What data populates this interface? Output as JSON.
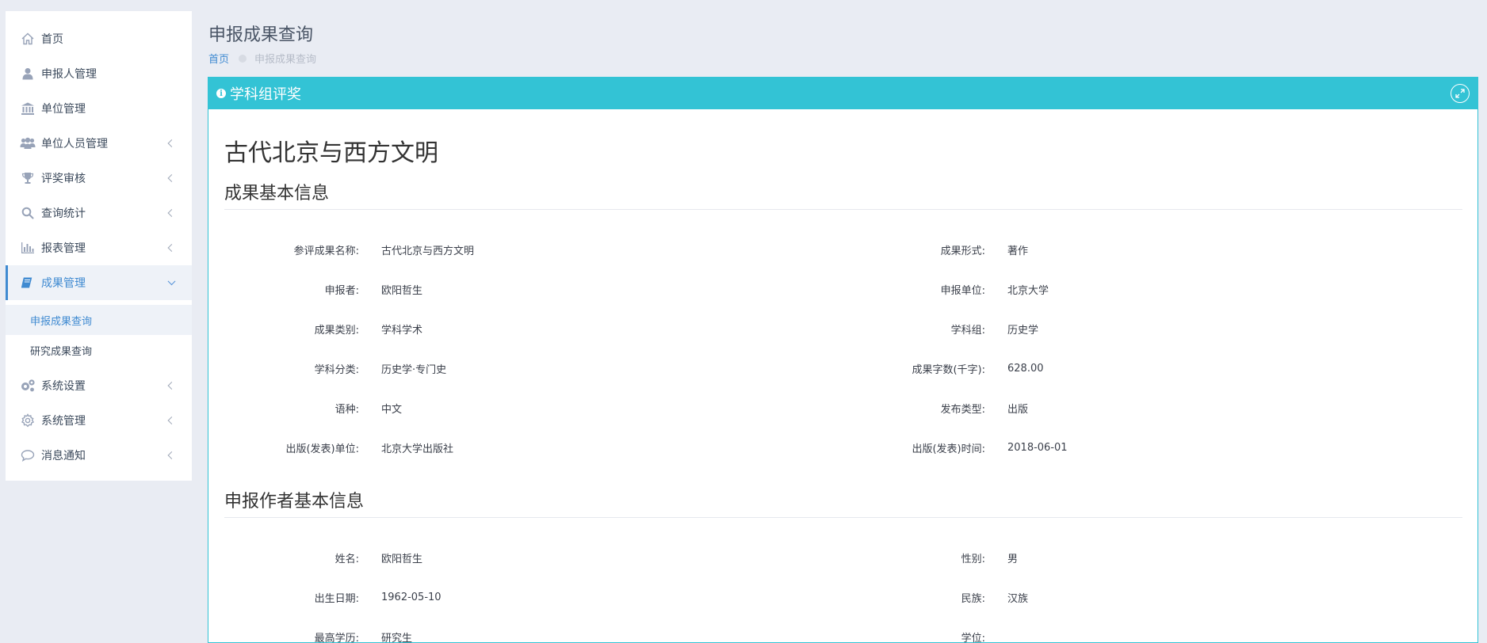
{
  "sidebar": {
    "items": [
      {
        "label": "首页",
        "icon": "home-icon"
      },
      {
        "label": "申报人管理",
        "icon": "user-icon"
      },
      {
        "label": "单位管理",
        "icon": "bank-icon"
      },
      {
        "label": "单位人员管理",
        "icon": "users-icon"
      },
      {
        "label": "评奖审核",
        "icon": "trophy-icon"
      },
      {
        "label": "查询统计",
        "icon": "search-icon"
      },
      {
        "label": "报表管理",
        "icon": "bar-chart-icon"
      },
      {
        "label": "成果管理",
        "icon": "book-icon"
      },
      {
        "label": "系统设置",
        "icon": "gears-icon"
      },
      {
        "label": "系统管理",
        "icon": "gear-icon"
      },
      {
        "label": "消息通知",
        "icon": "comment-icon"
      }
    ],
    "submenu": [
      {
        "label": "申报成果查询"
      },
      {
        "label": "研究成果查询"
      }
    ]
  },
  "header": {
    "title": "申报成果查询",
    "breadcrumb_home": "首页",
    "breadcrumb_current": "申报成果查询"
  },
  "panel": {
    "title": "学科组评奖",
    "work_title": "古代北京与西方文明",
    "section1_title": "成果基本信息",
    "section1_fields": [
      {
        "label": "参评成果名称:",
        "value": "古代北京与西方文明"
      },
      {
        "label": "成果形式:",
        "value": "著作"
      },
      {
        "label": "申报者:",
        "value": "欧阳哲生"
      },
      {
        "label": "申报单位:",
        "value": "北京大学"
      },
      {
        "label": "成果类别:",
        "value": "学科学术"
      },
      {
        "label": "学科组:",
        "value": "历史学"
      },
      {
        "label": "学科分类:",
        "value": "历史学·专门史"
      },
      {
        "label": "成果字数(千字):",
        "value": "628.00"
      },
      {
        "label": "语种:",
        "value": "中文"
      },
      {
        "label": "发布类型:",
        "value": "出版"
      },
      {
        "label": "出版(发表)单位:",
        "value": "北京大学出版社"
      },
      {
        "label": "出版(发表)时间:",
        "value": "2018-06-01"
      }
    ],
    "section2_title": "申报作者基本信息",
    "section2_fields": [
      {
        "label": "姓名:",
        "value": "欧阳哲生"
      },
      {
        "label": "性别:",
        "value": "男"
      },
      {
        "label": "出生日期:",
        "value": "1962-05-10"
      },
      {
        "label": "民族:",
        "value": "汉族"
      },
      {
        "label": "最高学历:",
        "value": "研究生"
      },
      {
        "label": "学位:",
        "value": ""
      }
    ]
  },
  "colors": {
    "panel_accent": "#33c3d5",
    "link": "#3f8ad1",
    "background": "#e9ecf3"
  }
}
